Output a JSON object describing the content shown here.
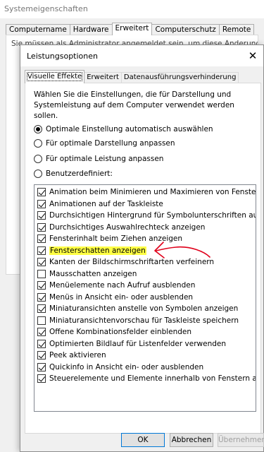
{
  "background_window": {
    "title": "Systemeigenschaften",
    "tabs": [
      "Computername",
      "Hardware",
      "Erweitert",
      "Computerschutz",
      "Remote"
    ],
    "active_tab_index": 2,
    "admin_text": "Sie müssen als Administrator angemeldet sein, um diese Änderungen durchführen"
  },
  "dialog": {
    "title": "Leistungsoptionen",
    "close_glyph": "✕",
    "tabs": [
      "Visuelle Effekte",
      "Erweitert",
      "Datenausführungsverhinderung"
    ],
    "active_tab_index": 0,
    "description": "Wählen Sie die Einstellungen, die für Darstellung und Systemleistung auf dem Computer verwendet werden sollen.",
    "radios": [
      {
        "label": "Optimale Einstellung automatisch auswählen",
        "selected": true
      },
      {
        "label": "Für optimale Darstellung anpassen",
        "selected": false
      },
      {
        "label": "Für optimale Leistung anpassen",
        "selected": false
      },
      {
        "label": "Benutzerdefiniert:",
        "selected": false
      }
    ],
    "effects": [
      {
        "label": "Animation beim Minimieren und Maximieren von Fenstern",
        "checked": true
      },
      {
        "label": "Animationen auf der Taskleiste",
        "checked": true
      },
      {
        "label": "Durchsichtigen Hintergrund für Symbolunterschriften auf dem Desktop",
        "checked": true
      },
      {
        "label": "Durchsichtiges Auswahlrechteck anzeigen",
        "checked": true
      },
      {
        "label": "Fensterinhalt beim Ziehen anzeigen",
        "checked": true
      },
      {
        "label": "Fensterschatten anzeigen",
        "checked": true,
        "highlighted": true
      },
      {
        "label": "Kanten der Bildschirmschriftarten verfeinern",
        "checked": true
      },
      {
        "label": "Mausschatten anzeigen",
        "checked": false
      },
      {
        "label": "Menüelemente nach Aufruf ausblenden",
        "checked": true
      },
      {
        "label": "Menüs in Ansicht ein- oder ausblenden",
        "checked": true
      },
      {
        "label": "Miniaturansichten anstelle von Symbolen anzeigen",
        "checked": true
      },
      {
        "label": "Miniaturansichtenvorschau für Taskleiste speichern",
        "checked": false
      },
      {
        "label": "Offene Kombinationsfelder einblenden",
        "checked": true
      },
      {
        "label": "Optimierten Bildlauf für Listenfelder verwenden",
        "checked": true
      },
      {
        "label": "Peek aktivieren",
        "checked": true
      },
      {
        "label": "Quickinfo in Ansicht ein- oder ausblenden",
        "checked": true
      },
      {
        "label": "Steuerelemente und Elemente innerhalb von Fenstern animieren",
        "checked": true
      }
    ],
    "buttons": {
      "ok": "OK",
      "cancel": "Abbrechen",
      "apply": "Übernehmen"
    },
    "apply_enabled": false
  },
  "colors": {
    "highlight": "#ffff44",
    "arrow": "#e0001a",
    "default_button_border": "#0078d7"
  },
  "icons": {
    "close": "close-icon",
    "annotation": "red-arrow-annotation"
  }
}
